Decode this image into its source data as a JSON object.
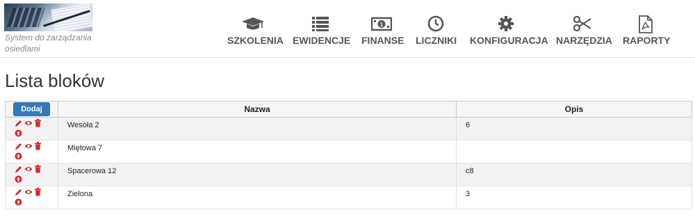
{
  "header": {
    "logo_text": "System do zarządzania osiedlami",
    "nav": [
      {
        "label": "SZKOLENIA",
        "icon": "graduation-cap-icon"
      },
      {
        "label": "EWIDENCJE",
        "icon": "list-icon"
      },
      {
        "label": "FINANSE",
        "icon": "money-icon"
      },
      {
        "label": "LICZNIKI",
        "icon": "clock-icon"
      },
      {
        "label": "KONFIGURACJA",
        "icon": "gear-icon"
      },
      {
        "label": "NARZĘDZIA",
        "icon": "scissors-icon"
      },
      {
        "label": "RAPORTY",
        "icon": "pdf-file-icon"
      }
    ]
  },
  "page": {
    "title": "Lista bloków"
  },
  "table": {
    "add_label": "Dodaj",
    "columns": [
      "Nazwa",
      "Opis"
    ],
    "rows": [
      {
        "nazwa": "Wesoła 2",
        "opis": "6"
      },
      {
        "nazwa": "Miętowa 7",
        "opis": ""
      },
      {
        "nazwa": "Spacerowa 12",
        "opis": "c8"
      },
      {
        "nazwa": "Zielona",
        "opis": "3"
      }
    ],
    "action_icons": [
      "pencil-icon",
      "eye-icon",
      "trash-icon",
      "arrow-up-circle-icon"
    ],
    "action_color": "#d9232d"
  },
  "colors": {
    "accent": "#337ab7",
    "nav_text": "#555555"
  }
}
